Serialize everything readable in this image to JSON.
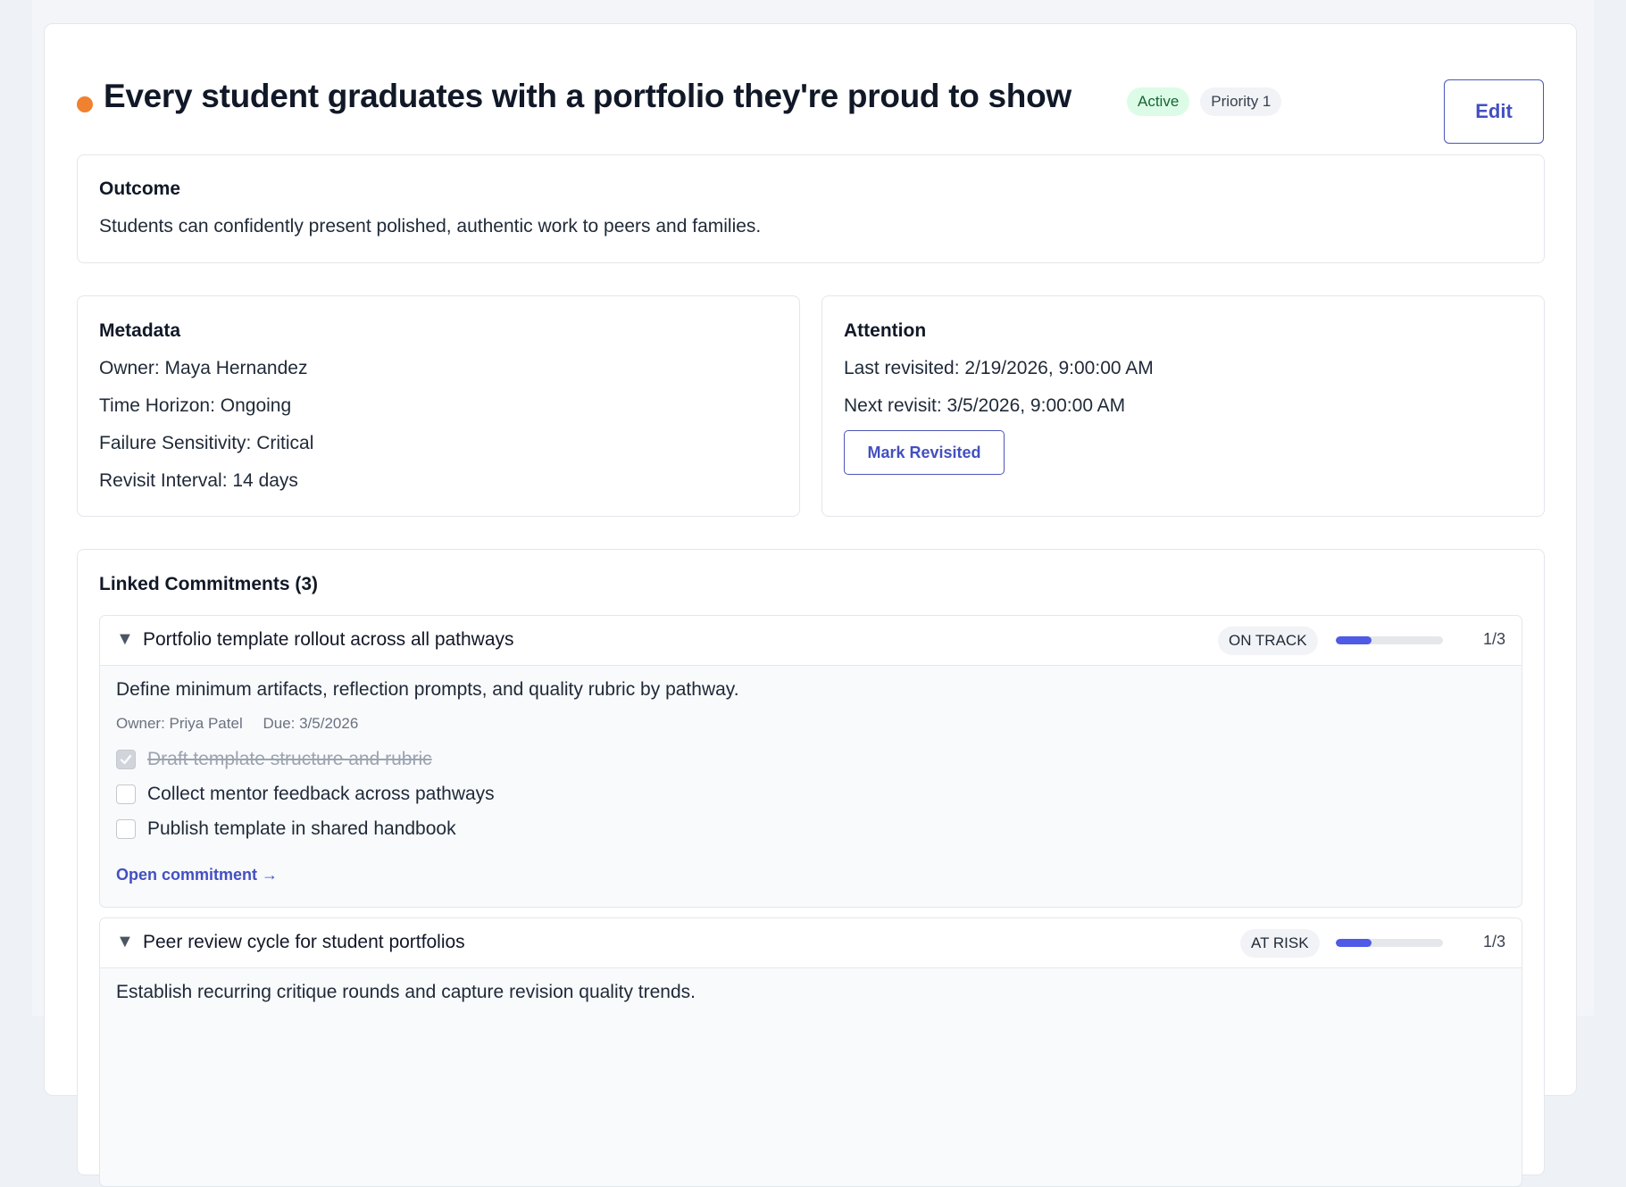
{
  "header": {
    "title": "Every student graduates with a portfolio they're proud to show",
    "status_badge": "Active",
    "priority_badge": "Priority 1",
    "edit_label": "Edit",
    "status_dot_color": "#f0812f"
  },
  "outcome": {
    "heading": "Outcome",
    "text": "Students can confidently present polished, authentic work to peers and families."
  },
  "metadata": {
    "heading": "Metadata",
    "owner": "Owner: Maya Hernandez",
    "time_horizon": "Time Horizon: Ongoing",
    "failure_sensitivity": "Failure Sensitivity: Critical",
    "revisit_interval": "Revisit Interval: 14 days"
  },
  "attention": {
    "heading": "Attention",
    "last_revisited": "Last revisited: 2/19/2026, 9:00:00 AM",
    "next_revisit": "Next revisit: 3/5/2026, 9:00:00 AM",
    "mark_revisited_label": "Mark Revisited"
  },
  "linked": {
    "heading": "Linked Commitments (3)",
    "commitments": [
      {
        "caret": "▼",
        "title": "Portfolio template rollout across all pathways",
        "status": "ON TRACK",
        "progress": 0.33,
        "count": "1/3",
        "description": "Define minimum artifacts, reflection prompts, and quality rubric by pathway.",
        "owner": "Owner: Priya Patel",
        "due": "Due: 3/5/2026",
        "tasks": [
          {
            "label": "Draft template structure and rubric",
            "done": true
          },
          {
            "label": "Collect mentor feedback across pathways",
            "done": false
          },
          {
            "label": "Publish template in shared handbook",
            "done": false
          }
        ],
        "open_link": "Open commitment →"
      },
      {
        "caret": "▼",
        "title": "Peer review cycle for student portfolios",
        "status": "AT RISK",
        "progress": 0.33,
        "count": "1/3",
        "description": "Establish recurring critique rounds and capture revision quality trends."
      }
    ]
  }
}
